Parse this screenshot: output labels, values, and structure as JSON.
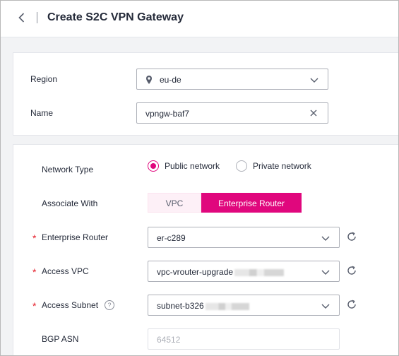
{
  "header": {
    "title": "Create S2C VPN Gateway"
  },
  "basic": {
    "region": {
      "label": "Region",
      "value": "eu-de"
    },
    "name": {
      "label": "Name",
      "value": "vpngw-baf7"
    }
  },
  "network": {
    "network_type": {
      "label": "Network Type",
      "options": [
        "Public network",
        "Private network"
      ],
      "selected": "Public network"
    },
    "associate_with": {
      "label": "Associate With",
      "options": [
        "VPC",
        "Enterprise Router"
      ],
      "selected": "Enterprise Router"
    },
    "enterprise_router": {
      "label": "Enterprise Router",
      "value": "er-c289"
    },
    "access_vpc": {
      "label": "Access VPC",
      "value": "vpc-vrouter-upgrade"
    },
    "access_subnet": {
      "label": "Access Subnet",
      "value": "subnet-b326",
      "help": "?"
    },
    "bgp_asn": {
      "label": "BGP ASN",
      "placeholder": "64512"
    }
  },
  "colors": {
    "accent": "#e0077d",
    "required": "#e5202c"
  }
}
